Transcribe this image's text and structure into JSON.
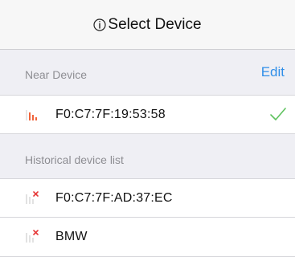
{
  "header": {
    "title": "Select Device",
    "info_icon": "info-circle-icon"
  },
  "near_section": {
    "title": "Near Device",
    "edit_label": "Edit",
    "devices": [
      {
        "name": "F0:C7:7F:19:53:58",
        "signal_icon": "signal-weak-icon",
        "selected": true,
        "check_icon": "checkmark-icon"
      }
    ]
  },
  "history_section": {
    "title": "Historical device list",
    "devices": [
      {
        "name": "F0:C7:7F:AD:37:EC",
        "signal_icon": "signal-off-icon"
      },
      {
        "name": "BMW",
        "signal_icon": "signal-off-icon"
      }
    ]
  },
  "colors": {
    "accent": "#2f8ee8",
    "check": "#5fc25f",
    "signal_active": "#f0643c",
    "signal_off_x": "#e63a3a",
    "background": "#efeff4"
  }
}
